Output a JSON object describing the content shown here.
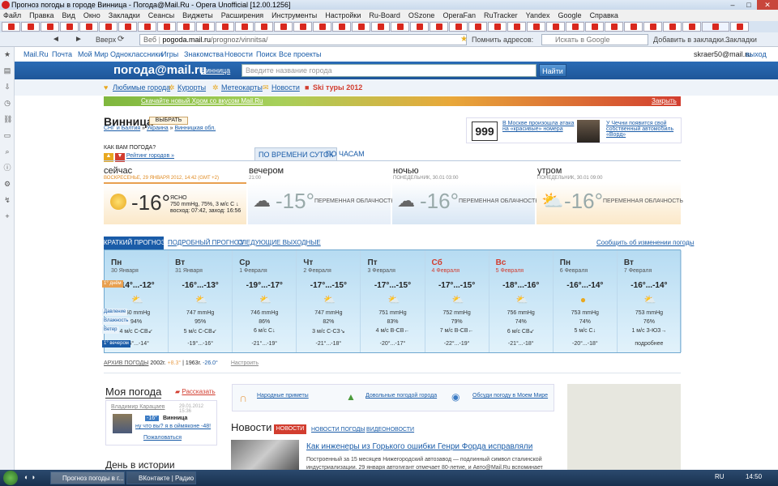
{
  "window": {
    "title": "Прогноз погоды в городе Винница - Погода@Mail.Ru - Opera Unofficial [12.00.1256]"
  },
  "menu": [
    "Файл",
    "Правка",
    "Вид",
    "Окно",
    "Закладки",
    "Сеансы",
    "Виджеты",
    "Расширения",
    "Инструменты",
    "Настройки",
    "Ru-Board",
    "OSzone",
    "OperaFan",
    "RuTracker",
    "Yandex",
    "Google",
    "Справка"
  ],
  "nav": {
    "back": "◄",
    "forward": "►",
    "up_label": "Вверх",
    "url_prefix": "Веб",
    "url_host": "pogoda.mail.ru",
    "url_path": "/prognoz/vinnitsa/",
    "remember": "Помнить адресов:",
    "search_placeholder": "Искать в Google",
    "add_bookmark": "Добавить в закладки...",
    "bookmarks": "Закладки"
  },
  "mailtop": {
    "items": [
      "Mail.Ru",
      "Почта",
      "Мой Мир",
      "Одноклассники",
      "Игры",
      "Знакомства",
      "Новости",
      "Поиск",
      "Все проекты"
    ],
    "user": "skraer50@mail.ru",
    "logout": "выход"
  },
  "header": {
    "logo": "погода@mail.ru",
    "city_link": "Винница",
    "input_placeholder": "Введите название города",
    "find": "Найти"
  },
  "subnav": [
    "Любимые города",
    "Курорты",
    "Метеокарты",
    "Новости",
    "Ski туры 2012"
  ],
  "banner": {
    "text": "Скачайте новый Хром со вкусом Mail.Ru",
    "close": "Закрыть"
  },
  "city": {
    "name": "Винница",
    "select": "ВЫБРАТЬ",
    "crumbs": "СНГ и Балтия",
    "crumbs2": "Украина",
    "crumbs3": "Винницкая обл.",
    "how": "КАК ВАМ ПОГОДА?",
    "rating": "Рейтинг городов »"
  },
  "ad": {
    "number": "999",
    "text": "В Москве произошла атака на «красивые» номера",
    "text2": "У Чечни появится свой собственный автомобиль «Ворд»"
  },
  "period_tabs": [
    "ПО ВРЕМЕНИ СУТОК",
    "ПО ЧАСАМ"
  ],
  "now": {
    "now_label": "сейчас",
    "now_sub": "ВОСКРЕСЕНЬЕ, 29 ЯНВАРЯ 2012, 14:42 (GMT +2)",
    "now_temp": "-16°",
    "now_desc1": "ЯСНО",
    "now_desc2": "750 mmHg, 75%, 3 м/с С ↓",
    "now_desc3": "восход: 07:42, заход: 16:56",
    "eve_label": "вечером",
    "eve_sub": "21:00",
    "eve_temp": "-15°",
    "eve_desc": "ПЕРЕМЕННАЯ ОБЛАЧНОСТЬ",
    "night_label": "ночью",
    "night_sub": "ПОНЕДЕЛЬНИК, 30.01 03:00",
    "night_temp": "-16°",
    "night_desc": "ПЕРЕМЕННАЯ ОБЛАЧНОСТЬ",
    "morn_label": "утром",
    "morn_sub": "ПОНЕДЕЛЬНИК, 30.01 09:00",
    "morn_temp": "-16°",
    "morn_desc": "ПЕРЕМЕННАЯ ОБЛАЧНОСТЬ"
  },
  "forecast_tabs": [
    "КРАТКИЙ ПРОГНОЗ",
    "ПОДРОБНЫЙ ПРОГНОЗ",
    "СЛЕДУЮЩИЕ ВЫХОДНЫЕ"
  ],
  "forecast_notify": "Сообщить об изменении погоды",
  "row_labels": {
    "day": "1° днём",
    "pressure": "Давление",
    "humidity": "Влажность",
    "wind": "Ветер",
    "evening": "1° вечером"
  },
  "days": [
    {
      "dn": "Пн",
      "dd": "30 Января",
      "tr": "-14°...-12°",
      "p": "750 mmHg",
      "h": "94%",
      "w": "4 м/с С-СВ↙",
      "ev": "-15°...-14°"
    },
    {
      "dn": "Вт",
      "dd": "31 Января",
      "tr": "-16°...-13°",
      "p": "747 mmHg",
      "h": "95%",
      "w": "5 м/с С-СВ↙",
      "ev": "-19°...-16°"
    },
    {
      "dn": "Ср",
      "dd": "1 Февраля",
      "tr": "-19°...-17°",
      "p": "746 mmHg",
      "h": "86%",
      "w": "6 м/с С↓",
      "ev": "-21°...-19°"
    },
    {
      "dn": "Чт",
      "dd": "2 Февраля",
      "tr": "-17°...-15°",
      "p": "747 mmHg",
      "h": "82%",
      "w": "3 м/с С-СЗ↘",
      "ev": "-21°...-18°"
    },
    {
      "dn": "Пт",
      "dd": "3 Февраля",
      "tr": "-17°...-15°",
      "p": "751 mmHg",
      "h": "83%",
      "w": "4 м/с В-СВ←",
      "ev": "-20°...-17°"
    },
    {
      "dn": "Сб",
      "dd": "4 Февраля",
      "tr": "-17°...-15°",
      "p": "752 mmHg",
      "h": "79%",
      "w": "7 м/с В-СВ←",
      "ev": "-22°...-19°"
    },
    {
      "dn": "Вс",
      "dd": "5 Февраля",
      "tr": "-18°...-16°",
      "p": "756 mmHg",
      "h": "74%",
      "w": "6 м/с СВ↙",
      "ev": "-21°...-18°"
    },
    {
      "dn": "Пн",
      "dd": "6 Февраля",
      "tr": "-16°...-14°",
      "p": "753 mmHg",
      "h": "74%",
      "w": "5 м/с С↓",
      "ev": "-20°...-18°"
    },
    {
      "dn": "Вт",
      "dd": "7 Февраля",
      "tr": "-16°...-14°",
      "p": "753 mmHg",
      "h": "76%",
      "w": "1 м/с З-ЮЗ→",
      "ev": "подробнее"
    }
  ],
  "archive": {
    "label": "АРХИВ ПОГОДЫ",
    "y1": "2002г.",
    "v1": "+8.3°",
    "y2": "1963г.",
    "v2": "-26.0°",
    "config": "Настроить"
  },
  "my": {
    "title": "Моя погода",
    "tell": "Рассказать",
    "user": "Владимир Карацаев",
    "date": "29.01.2012 15:36",
    "temp": "-16°",
    "city": "Винница",
    "msg": "ну что вы? я в оймяконе -48!",
    "complain": "Пожаловаться"
  },
  "folk": [
    "Народные приметы",
    "Довольные погодой города",
    "Обсуди погоду в Моем Мире"
  ],
  "news": {
    "title": "Новости",
    "tabs": [
      "НОВОСТИ",
      "НОВОСТИ ПОГОДЫ",
      "ВИДЕОНОВОСТИ"
    ],
    "headline": "Как инженеры из Горького ошибки Генри Форда исправляли",
    "body": "Построенный за 15 месяцев Нижегородский автозавод — подлинный символ сталинской индустриализации. 29 января автогигант отмечает 80-летие, и Авто@Mail.Ru вспоминает"
  },
  "history": "День в истории",
  "taskbar": {
    "task1": "Прогноз погоды в г...",
    "task2": "ВКонтакте | Радио - ...",
    "lang": "RU",
    "time": "14:50"
  }
}
